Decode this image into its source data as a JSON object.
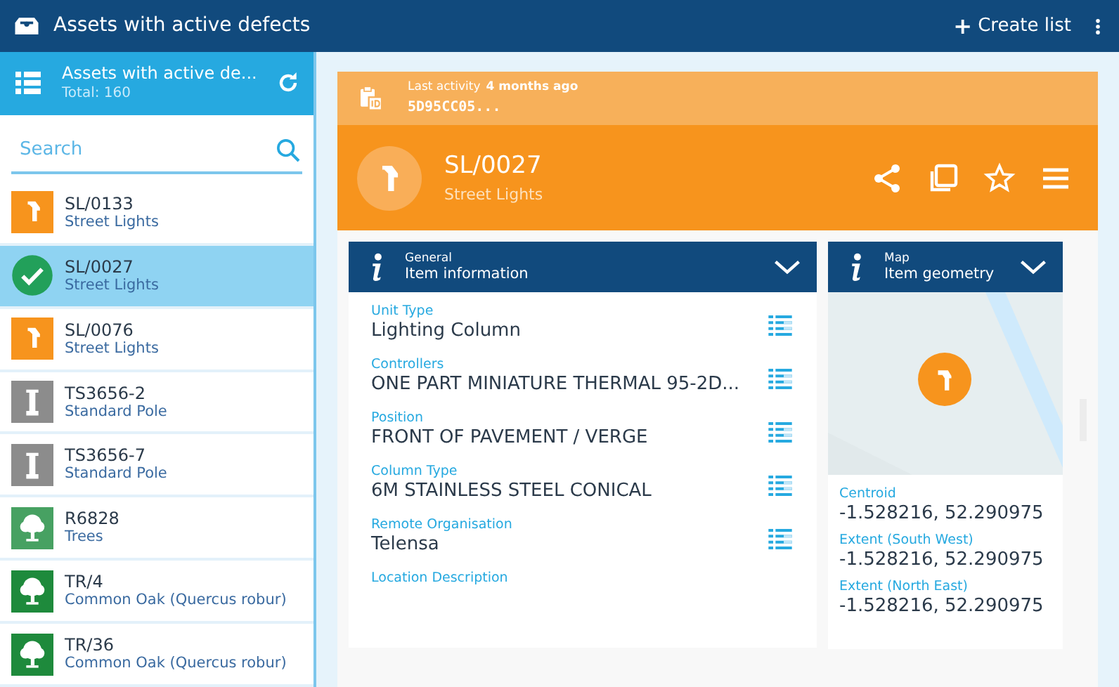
{
  "app_bar": {
    "title": "Assets with active defects",
    "create_button": "Create list",
    "create_icon": "+"
  },
  "sidebar": {
    "list_title": "Assets with active de...",
    "total": "Total: 160",
    "search": {
      "placeholder": "Search"
    },
    "items": [
      {
        "code": "SL/0133",
        "category": "Street Lights",
        "kind": "streetlight",
        "color": "#f7941d",
        "selected": false
      },
      {
        "code": "SL/0027",
        "category": "Street Lights",
        "selected": true
      },
      {
        "code": "SL/0076",
        "category": "Street Lights",
        "kind": "streetlight",
        "color": "#f7941d",
        "selected": false
      },
      {
        "code": "TS3656-2",
        "category": "Standard Pole",
        "kind": "pole",
        "color": "#8c8c8c",
        "selected": false
      },
      {
        "code": "TS3656-7",
        "category": "Standard Pole",
        "kind": "pole",
        "color": "#8c8c8c",
        "selected": false
      },
      {
        "code": "R6828",
        "category": "Trees",
        "kind": "tree",
        "color": "#47a162",
        "selected": false
      },
      {
        "code": "TR/4",
        "category": "Common Oak (Quercus robur)",
        "kind": "tree",
        "color": "#1e8a3c",
        "selected": false
      },
      {
        "code": "TR/36",
        "category": "Common Oak (Quercus robur)",
        "kind": "tree",
        "color": "#1e8a3c",
        "selected": false
      }
    ]
  },
  "detail": {
    "activity_label": "Last activity",
    "activity_time": "4 months ago",
    "id": "5D95CC05...",
    "code": "SL/0027",
    "category": "Street Lights",
    "general": {
      "kicker": "General",
      "title": "Item information",
      "fields": [
        {
          "label": "Unit Type",
          "value": "Lighting Column"
        },
        {
          "label": "Controllers",
          "value": "ONE PART MINIATURE THERMAL 95-2D..."
        },
        {
          "label": "Position",
          "value": "FRONT OF PAVEMENT / VERGE"
        },
        {
          "label": "Column Type",
          "value": "6M STAINLESS STEEL CONICAL"
        },
        {
          "label": "Remote Organisation",
          "value": "Telensa"
        },
        {
          "label": "Location Description"
        }
      ]
    },
    "map": {
      "kicker": "Map",
      "title": "Item geometry",
      "fields": [
        {
          "label": "Centroid",
          "value": "-1.528216, 52.290975"
        },
        {
          "label": "Extent (South West)",
          "value": "-1.528216, 52.290975"
        },
        {
          "label": "Extent (North East)",
          "value": "-1.528216, 52.290975"
        }
      ]
    }
  }
}
